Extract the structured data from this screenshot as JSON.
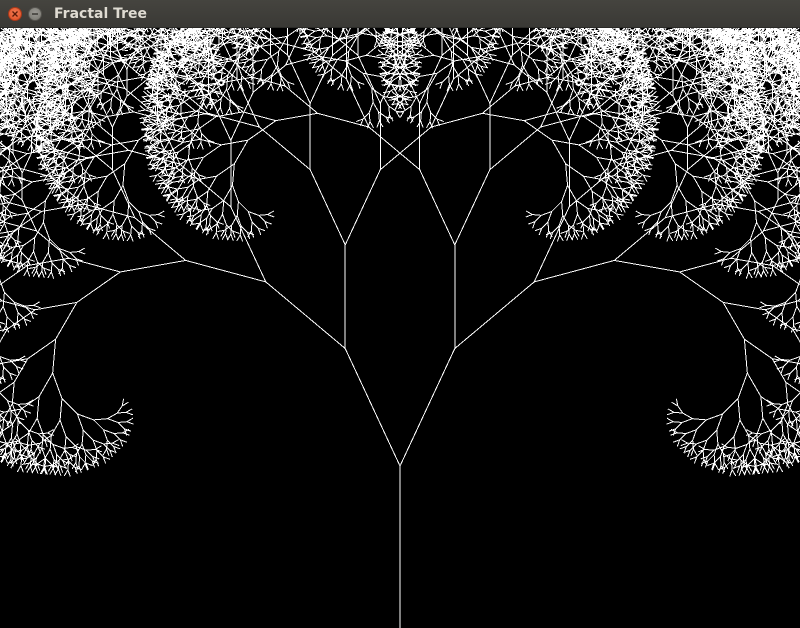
{
  "window": {
    "title": "Fractal Tree",
    "buttons": [
      {
        "name": "close",
        "icon": "close-icon"
      },
      {
        "name": "minimize",
        "icon": "minimize-icon"
      }
    ]
  },
  "canvas": {
    "background": "#000000",
    "stroke_color": "#ffffff"
  }
}
